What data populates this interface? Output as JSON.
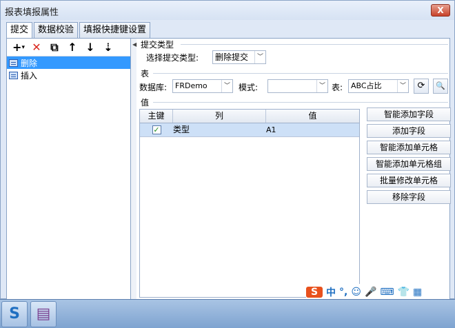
{
  "window": {
    "title": "报表填报属性",
    "close_label": "X"
  },
  "tabs": [
    "提交",
    "数据校验",
    "填报快捷键设置"
  ],
  "toolbar": {
    "icons": [
      "add-icon",
      "delete-icon",
      "copy-icon",
      "move-up-icon",
      "move-down-icon",
      "sort-icon"
    ],
    "glyphs": {
      "add": "+",
      "dropdown": "▾",
      "delete": "✕",
      "copy": "⧉",
      "up": "↑",
      "down": "↓",
      "sort": "⇣"
    }
  },
  "tree": [
    {
      "label": "删除",
      "selected": true
    },
    {
      "label": "插入",
      "selected": false
    }
  ],
  "submit_type": {
    "section": "提交类型",
    "label": "选择提交类型:",
    "value": "删除提交"
  },
  "table_section": {
    "section": "表",
    "db_label": "数据库:",
    "db_value": "FRDemo",
    "mode_label": "模式:",
    "mode_value": "",
    "table_label": "表:",
    "table_value": "ABC占比",
    "refresh_glyph": "⟳",
    "preview_glyph": "🔍"
  },
  "value_section": {
    "section": "值",
    "columns": [
      "主键",
      "列",
      "值"
    ],
    "rows": [
      {
        "key": true,
        "column": "类型",
        "value": "A1"
      }
    ],
    "check_glyph": "✓"
  },
  "side_buttons": [
    "智能添加字段",
    "添加字段",
    "智能添加单元格",
    "智能添加单元格组",
    "批量修改单元格",
    "移除字段"
  ],
  "ime": {
    "logo": "S",
    "items": [
      "中",
      "°,",
      "☺",
      "🎤",
      "⌨",
      "👕",
      "▦"
    ]
  },
  "taskbar": {
    "apps": [
      "S",
      "▤"
    ]
  },
  "colors": {
    "selection": "#3399ff",
    "row_highlight": "#cde0f7",
    "delete_red": "#d9271e"
  }
}
